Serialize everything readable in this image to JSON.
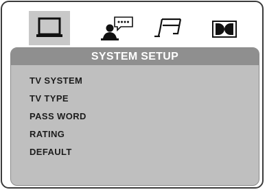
{
  "tabs": [
    {
      "icon": "tv-icon",
      "selected": true
    },
    {
      "icon": "language-speaker-icon",
      "selected": false
    },
    {
      "icon": "music-note-icon",
      "selected": false
    },
    {
      "icon": "dolby-icon",
      "selected": false
    }
  ],
  "panel": {
    "title": "SYSTEM SETUP",
    "items": [
      {
        "label": "TV SYSTEM"
      },
      {
        "label": "TV TYPE"
      },
      {
        "label": "PASS WORD"
      },
      {
        "label": "RATING"
      },
      {
        "label": "DEFAULT"
      }
    ]
  },
  "colors": {
    "selected_tab": "#c8c8c8",
    "panel_bg": "#bfbfbf",
    "header_bg": "#8f8f8f",
    "header_text": "#ffffff",
    "item_text": "#1c1c1c"
  }
}
